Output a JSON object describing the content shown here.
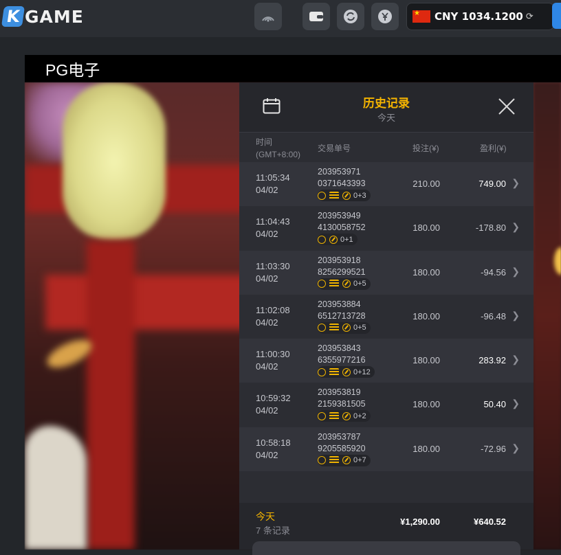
{
  "topbar": {
    "logo_k": "K",
    "logo_text": "GAME",
    "balance": "CNY 1034.1200"
  },
  "game": {
    "title": "PG电子"
  },
  "history": {
    "title": "历史记录",
    "subtitle": "今天",
    "col_time": "时间",
    "col_tz": "(GMT+8:00)",
    "col_id": "交易单号",
    "col_bet": "投注(¥)",
    "col_win": "盈利(¥)",
    "rows": [
      {
        "time": "11:05:34",
        "date": "04/02",
        "id1": "203953971",
        "id2": "0371643393",
        "coins": true,
        "fs": "0+3",
        "bet": "210.00",
        "win": "749.00",
        "pos": true
      },
      {
        "time": "11:04:43",
        "date": "04/02",
        "id1": "203953949",
        "id2": "4130058752",
        "coins": false,
        "fs": "0+1",
        "bet": "180.00",
        "win": "-178.80",
        "pos": false
      },
      {
        "time": "11:03:30",
        "date": "04/02",
        "id1": "203953918",
        "id2": "8256299521",
        "coins": true,
        "fs": "0+5",
        "bet": "180.00",
        "win": "-94.56",
        "pos": false
      },
      {
        "time": "11:02:08",
        "date": "04/02",
        "id1": "203953884",
        "id2": "6512713728",
        "coins": true,
        "fs": "0+5",
        "bet": "180.00",
        "win": "-96.48",
        "pos": false
      },
      {
        "time": "11:00:30",
        "date": "04/02",
        "id1": "203953843",
        "id2": "6355977216",
        "coins": true,
        "fs": "0+12",
        "bet": "180.00",
        "win": "283.92",
        "pos": true
      },
      {
        "time": "10:59:32",
        "date": "04/02",
        "id1": "203953819",
        "id2": "2159381505",
        "coins": true,
        "fs": "0+2",
        "bet": "180.00",
        "win": "50.40",
        "pos": true
      },
      {
        "time": "10:58:18",
        "date": "04/02",
        "id1": "203953787",
        "id2": "9205585920",
        "coins": true,
        "fs": "0+7",
        "bet": "180.00",
        "win": "-72.96",
        "pos": false
      }
    ],
    "footer": {
      "label": "今天",
      "count": "7 条记录",
      "total_bet": "¥1,290.00",
      "total_win": "¥640.52"
    }
  },
  "colors": {
    "accent": "#f5b400",
    "panel_bg": "#2c2d33",
    "topbar_bg": "#2b2e33"
  }
}
